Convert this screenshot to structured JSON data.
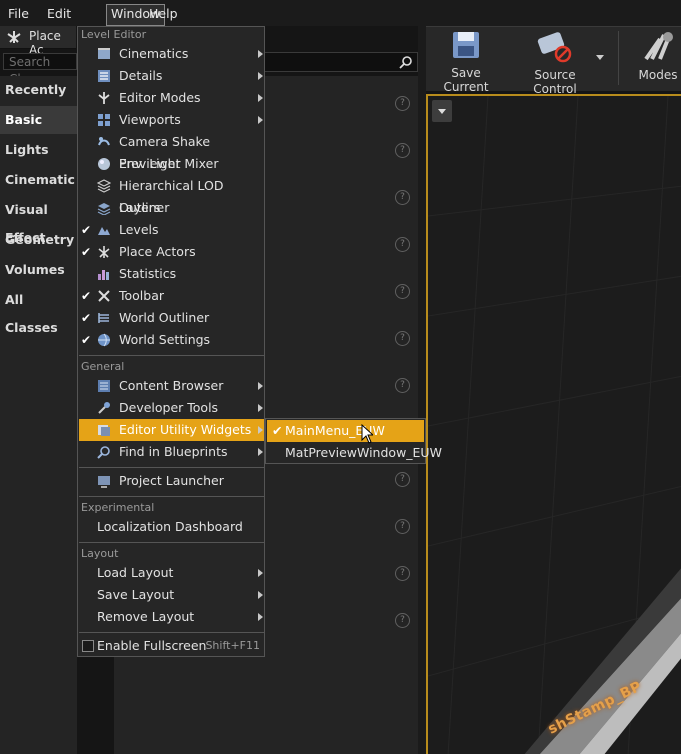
{
  "menubar": {
    "items": [
      "File",
      "Edit",
      "Window",
      "Help"
    ],
    "active": "Window"
  },
  "panel": {
    "tab_label": "Place Ac",
    "search_placeholder": "Search Class",
    "categories": [
      "Recently Pla",
      "Basic",
      "Lights",
      "Cinematic",
      "Visual Effect",
      "Geometry",
      "Volumes",
      "All Classes"
    ],
    "selected_category": "Basic"
  },
  "toolbar": {
    "save_label": "Save Current",
    "source_control_label": "Source Control",
    "modes_label": "Modes"
  },
  "viewport": {
    "actor_label": "shStamp_BP"
  },
  "menu": {
    "sections": {
      "level_editor": "Level Editor",
      "general": "General",
      "experimental": "Experimental",
      "layout": "Layout"
    },
    "level_editor_items": [
      {
        "label": "Cinematics",
        "icon": "cinematics-icon",
        "checked": false,
        "submenu": true
      },
      {
        "label": "Details",
        "icon": "details-icon",
        "checked": false,
        "submenu": true
      },
      {
        "label": "Editor Modes",
        "icon": "editor-modes-icon",
        "checked": false,
        "submenu": true
      },
      {
        "label": "Viewports",
        "icon": "viewports-icon",
        "checked": false,
        "submenu": true
      },
      {
        "label": "Camera Shake Previewer",
        "icon": "camera-shake-icon",
        "checked": false,
        "submenu": false
      },
      {
        "label": "Env. Light Mixer",
        "icon": "light-mixer-icon",
        "checked": false,
        "submenu": false
      },
      {
        "label": "Hierarchical LOD Outliner",
        "icon": "lod-outliner-icon",
        "checked": false,
        "submenu": false
      },
      {
        "label": "Layers",
        "icon": "layers-icon",
        "checked": false,
        "submenu": false
      },
      {
        "label": "Levels",
        "icon": "levels-icon",
        "checked": true,
        "submenu": false
      },
      {
        "label": "Place Actors",
        "icon": "place-actors-icon",
        "checked": true,
        "submenu": false
      },
      {
        "label": "Statistics",
        "icon": "statistics-icon",
        "checked": false,
        "submenu": false
      },
      {
        "label": "Toolbar",
        "icon": "toolbar-icon",
        "checked": true,
        "submenu": false
      },
      {
        "label": "World Outliner",
        "icon": "world-outliner-icon",
        "checked": true,
        "submenu": false
      },
      {
        "label": "World Settings",
        "icon": "world-settings-icon",
        "checked": true,
        "submenu": false
      }
    ],
    "general_items": [
      {
        "label": "Content Browser",
        "icon": "content-browser-icon",
        "submenu": true
      },
      {
        "label": "Developer Tools",
        "icon": "developer-tools-icon",
        "submenu": true
      },
      {
        "label": "Editor Utility Widgets",
        "icon": "utility-widgets-icon",
        "submenu": true
      },
      {
        "label": "Find in Blueprints",
        "icon": "find-blueprints-icon",
        "submenu": true
      },
      {
        "label": "Project Launcher",
        "icon": "project-launcher-icon",
        "submenu": false
      }
    ],
    "experimental_items": [
      {
        "label": "Localization Dashboard"
      }
    ],
    "layout_items": [
      {
        "label": "Load Layout",
        "submenu": true
      },
      {
        "label": "Save Layout",
        "submenu": true
      },
      {
        "label": "Remove Layout",
        "submenu": true
      }
    ],
    "fullscreen": {
      "label": "Enable Fullscreen",
      "shortcut": "Shift+F11"
    }
  },
  "submenu": {
    "items": [
      {
        "label": "MainMenu_EUW",
        "checked": true
      },
      {
        "label": "MatPreviewWindow_EUW",
        "checked": false
      }
    ]
  },
  "colors": {
    "highlight": "#e5a317",
    "menu_bg": "#262626",
    "viewport_border": "#b88c1c"
  }
}
